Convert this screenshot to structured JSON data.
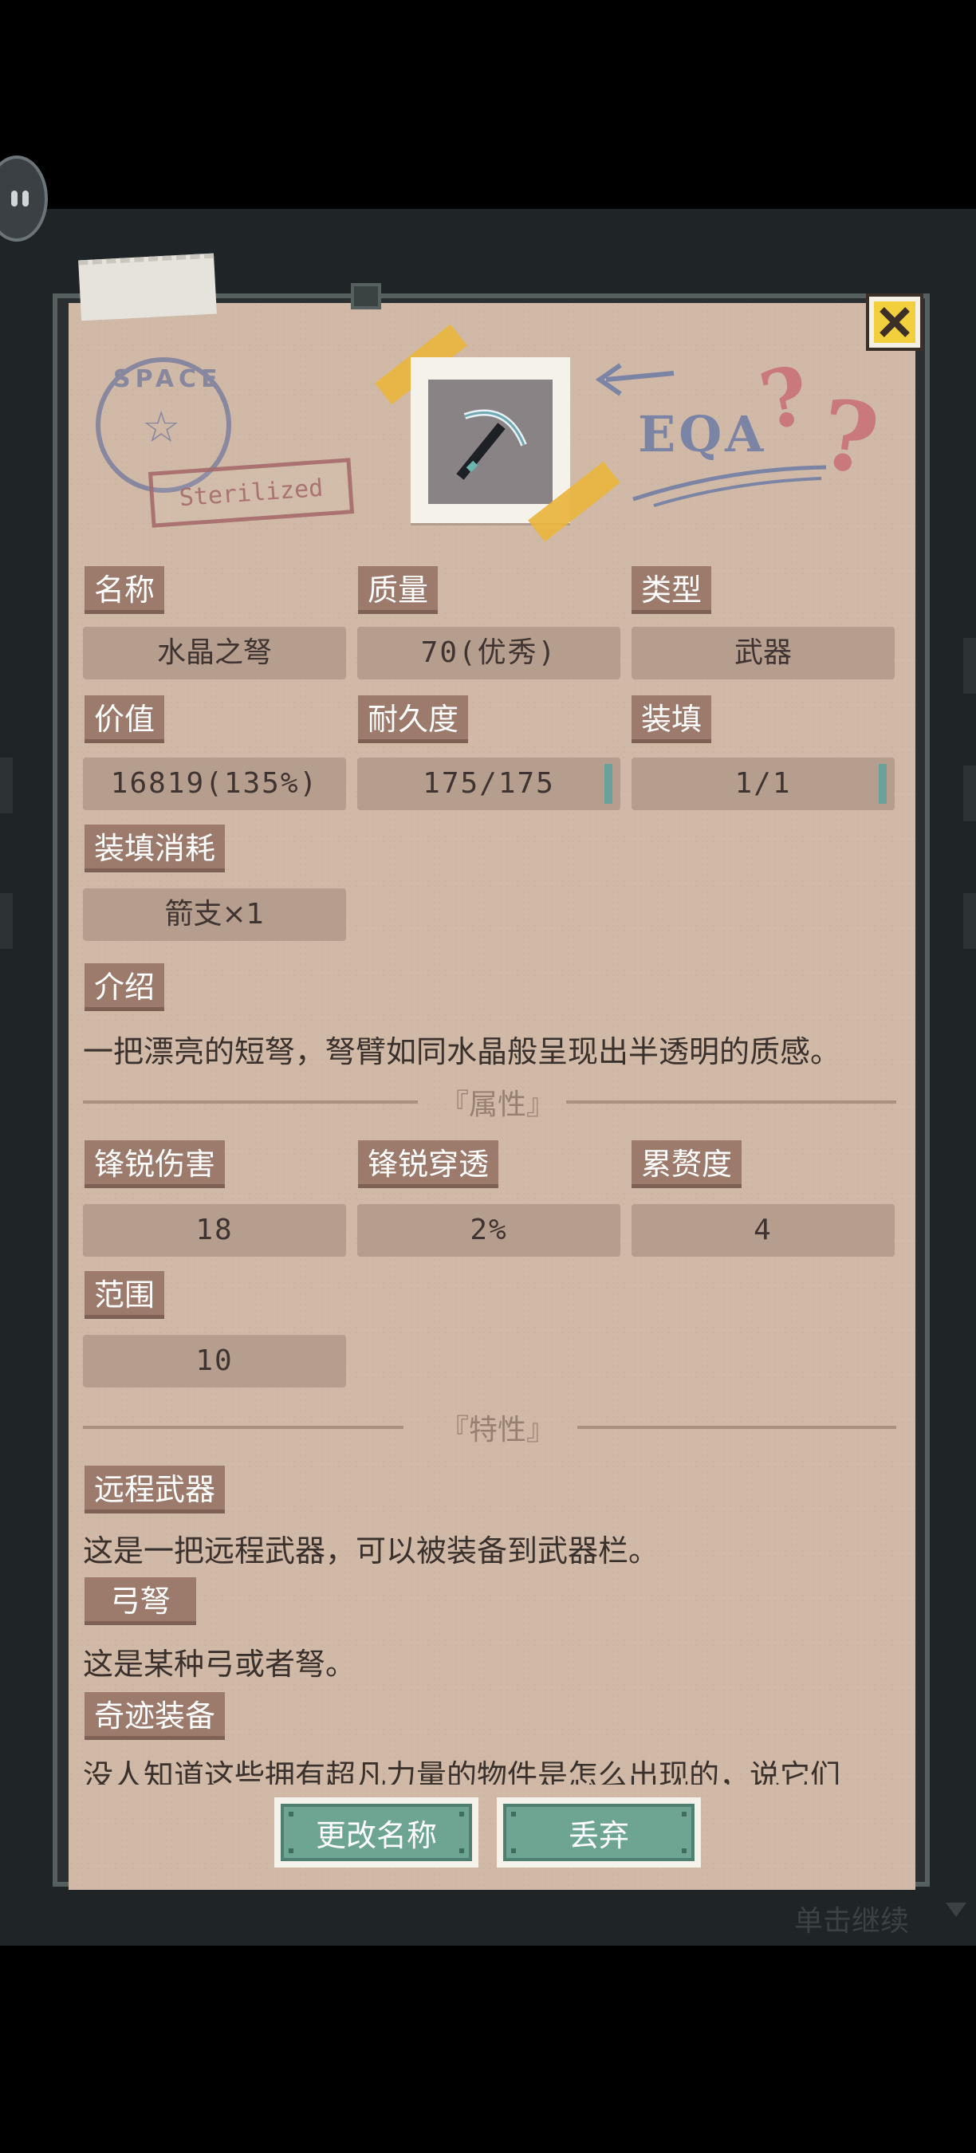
{
  "item": {
    "name_label": "名称",
    "name": "水晶之弩",
    "quality_label": "质量",
    "quality": "70(优秀)",
    "type_label": "类型",
    "type": "武器",
    "value_label": "价值",
    "value": "16819(135%)",
    "durability_label": "耐久度",
    "durability": "175/175",
    "load_label": "装填",
    "load": "1/1",
    "load_cost_label": "装填消耗",
    "load_cost": "箭支×1",
    "intro_label": "介绍",
    "intro": "一把漂亮的短弩，弩臂如同水晶般呈现出半透明的质感。"
  },
  "attributes": {
    "title": "『属性』",
    "sharp_damage_label": "锋锐伤害",
    "sharp_damage": "18",
    "sharp_pierce_label": "锋锐穿透",
    "sharp_pierce": "2%",
    "fatigue_label": "累赘度",
    "fatigue": "4",
    "range_label": "范围",
    "range": "10"
  },
  "traits": {
    "title": "『特性』",
    "items": [
      {
        "label": "远程武器",
        "desc": "这是一把远程武器，可以被装备到武器栏。"
      },
      {
        "label": "弓弩",
        "desc": "这是某种弓或者弩。"
      },
      {
        "label": "奇迹装备",
        "desc": "没人知道这些拥有超凡力量的物件是怎么出现的，说它们"
      }
    ]
  },
  "decor": {
    "stamp_text": "SPACE",
    "sterilized": "Sterilized",
    "eqa": "EQA"
  },
  "buttons": {
    "rename": "更改名称",
    "discard": "丢弃"
  },
  "hint": {
    "continue": "单击继续"
  },
  "colors": {
    "paper": "#d0b9a6",
    "label": "#9c7a6c",
    "field": "#b59e8d",
    "accent": "#6ea492",
    "close": "#f2cf3c"
  }
}
